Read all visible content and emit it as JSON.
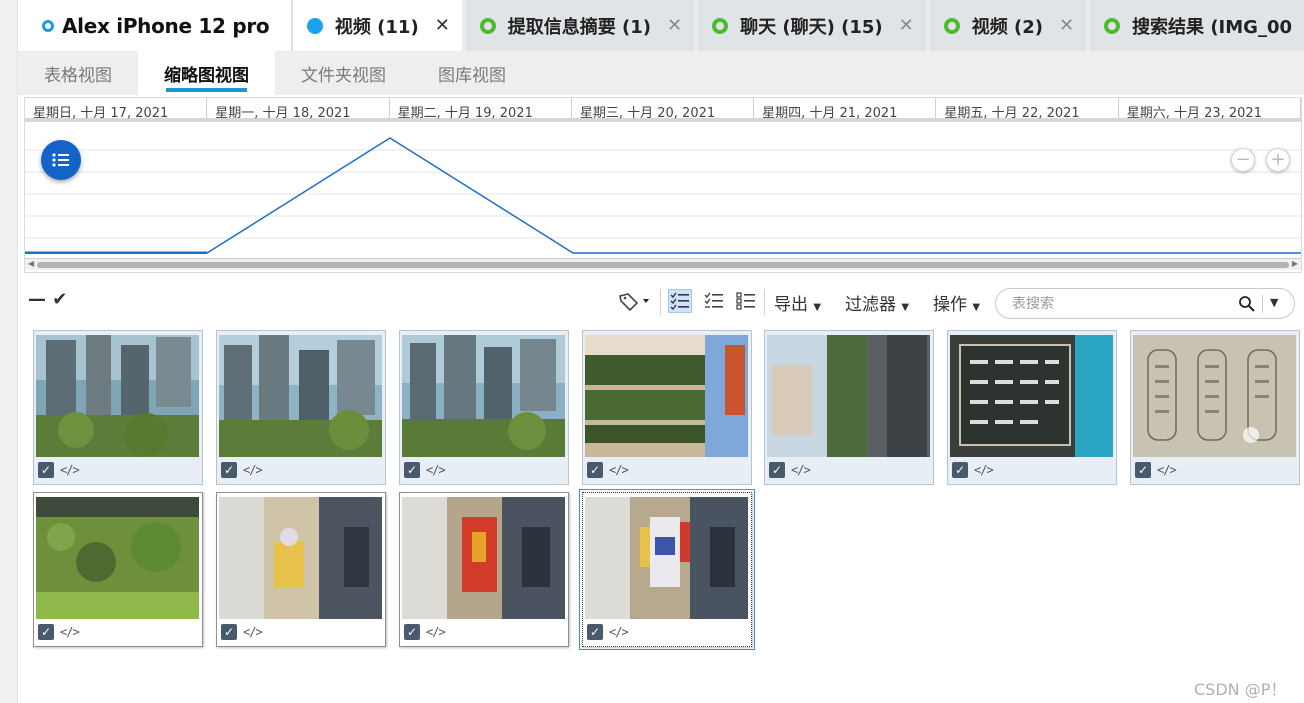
{
  "device": {
    "name": "Alex iPhone 12 pro"
  },
  "doc_tabs": [
    {
      "label": "视频 (11)",
      "active": true
    },
    {
      "label": "提取信息摘要 (1)",
      "active": false
    },
    {
      "label": "聊天 (聊天) (15)",
      "active": false
    },
    {
      "label": "视频 (2)",
      "active": false
    },
    {
      "label": "搜索结果 (IMG_00",
      "active": false
    }
  ],
  "view_tabs": [
    {
      "label": "表格视图",
      "active": false
    },
    {
      "label": "缩略图视图",
      "active": true
    },
    {
      "label": "文件夹视图",
      "active": false
    },
    {
      "label": "图库视图",
      "active": false
    }
  ],
  "timeline": {
    "dates": [
      "星期日, 十月 17, 2021",
      "星期一, 十月 18, 2021",
      "星期二, 十月 19, 2021",
      "星期三, 十月 20, 2021",
      "星期四, 十月 21, 2021",
      "星期五, 十月 22, 2021",
      "星期六, 十月 23, 2021"
    ],
    "peak_date": "星期二, 十月 19, 2021",
    "line_color": "#1a6fce"
  },
  "toolbar": {
    "export_label": "导出",
    "filter_label": "过滤器",
    "actions_label": "操作",
    "search_placeholder": "表搜索"
  },
  "thumbnails": [
    {
      "id": "t1",
      "scene": "city",
      "checked": true
    },
    {
      "id": "t2",
      "scene": "city",
      "checked": true
    },
    {
      "id": "t3",
      "scene": "city",
      "checked": true
    },
    {
      "id": "t4",
      "scene": "cactus",
      "checked": true
    },
    {
      "id": "t5",
      "scene": "street",
      "checked": true
    },
    {
      "id": "t6",
      "scene": "chalkboard",
      "checked": true
    },
    {
      "id": "t7",
      "scene": "paper",
      "checked": true
    },
    {
      "id": "t8",
      "scene": "aquarium",
      "checked": true
    },
    {
      "id": "t9",
      "scene": "figure-yellow",
      "checked": true
    },
    {
      "id": "t10",
      "scene": "figure-red",
      "checked": true
    },
    {
      "id": "t11",
      "scene": "figure-white",
      "checked": true,
      "selected": true
    }
  ],
  "watermark": "CSDN @P！",
  "colors": {
    "accent": "#1a96d8",
    "active_tab_dot": "#1aa3ee",
    "tab_ring": "#4cbb2c",
    "fab": "#1463c9"
  }
}
